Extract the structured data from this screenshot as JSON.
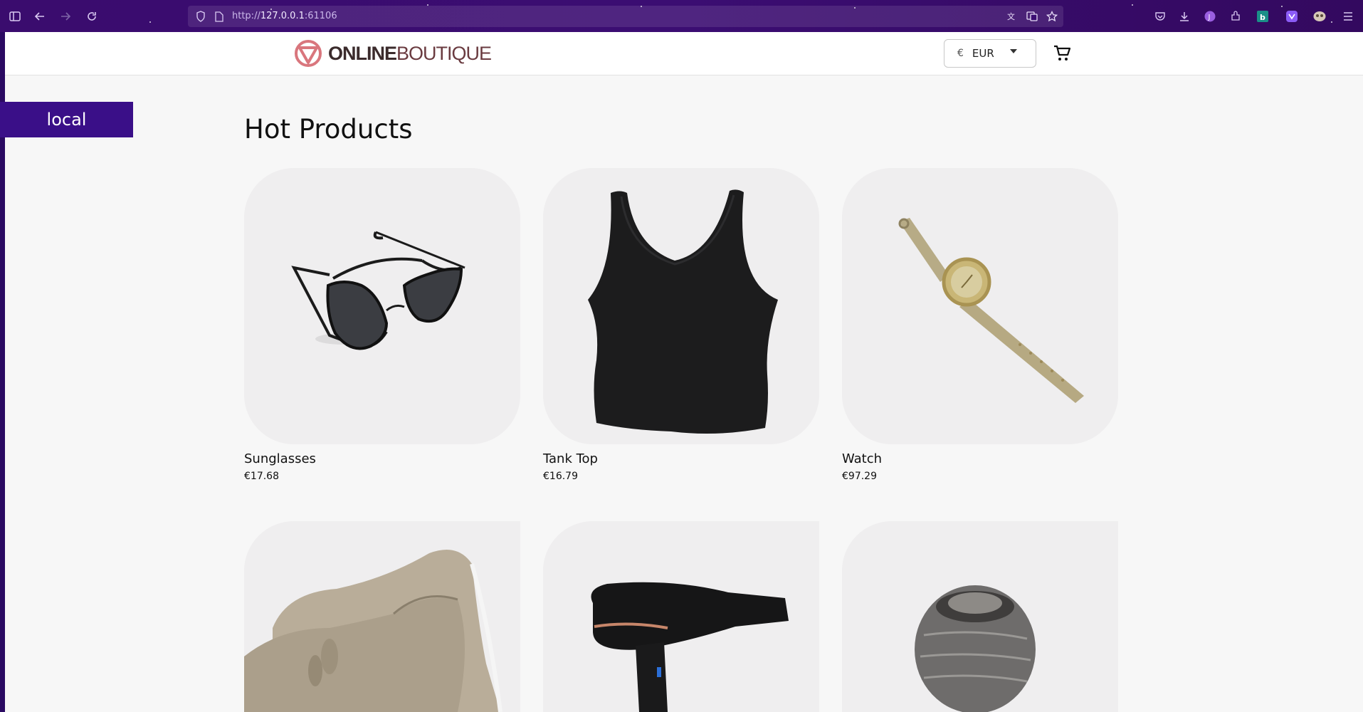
{
  "browser": {
    "url_prefix": "http://",
    "url_host": "127.0.0.1",
    "url_port": ":61106"
  },
  "header": {
    "logo_bold": "ONLINE",
    "logo_light": "BOUTIQUE",
    "currency_symbol": "€",
    "currency_code": "EUR",
    "cart_icon": "cart-icon"
  },
  "env_tag": {
    "label": "local"
  },
  "main": {
    "title": "Hot Products",
    "products": [
      {
        "name": "Sunglasses",
        "price": "€17.68",
        "icon": "sunglasses-image"
      },
      {
        "name": "Tank Top",
        "price": "€16.79",
        "icon": "tank-top-image"
      },
      {
        "name": "Watch",
        "price": "€97.29",
        "icon": "watch-image"
      },
      {
        "name": "",
        "price": "",
        "icon": "loafers-image"
      },
      {
        "name": "",
        "price": "",
        "icon": "hair-dryer-image"
      },
      {
        "name": "",
        "price": "",
        "icon": "candle-holder-image"
      }
    ]
  },
  "colors": {
    "browser_bar": "#3a0c6e",
    "env_tag_bg": "#3a0f88",
    "page_bg": "#f7f7f7",
    "logo_accent": "#d9767d"
  }
}
